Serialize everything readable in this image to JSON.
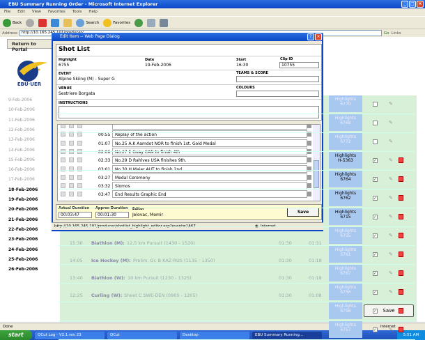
{
  "ie": {
    "title": "EBU Summary Running Order - Microsoft Internet Explorer",
    "menu": [
      "File",
      "Edit",
      "View",
      "Favorites",
      "Tools",
      "Help"
    ],
    "toolbar": {
      "back": "Back",
      "search": "Search",
      "favorites": "Favorites"
    },
    "address_label": "Address",
    "address": "http://10.165.245.101/producer/",
    "go": "Go",
    "links": "Links"
  },
  "page": {
    "return_label": "Return to Portal",
    "logo_text": "EBU·UER",
    "dates": [
      {
        "d": "9-Feb-2006",
        "bold": false
      },
      {
        "d": "10-Feb-2006",
        "bold": false
      },
      {
        "d": "11-Feb-2006",
        "bold": false
      },
      {
        "d": "12-Feb-2006",
        "bold": false
      },
      {
        "d": "13-Feb-2006",
        "bold": false
      },
      {
        "d": "14-Feb-2006",
        "bold": false
      },
      {
        "d": "15-Feb-2006",
        "bold": false
      },
      {
        "d": "16-Feb-2006",
        "bold": false
      },
      {
        "d": "17-Feb-2006",
        "bold": false
      },
      {
        "d": "18-Feb-2006",
        "bold": true
      },
      {
        "d": "19-Feb-2006",
        "bold": true
      },
      {
        "d": "20-Feb-2006",
        "bold": true
      },
      {
        "d": "21-Feb-2006",
        "bold": true
      },
      {
        "d": "22-Feb-2006",
        "bold": true
      },
      {
        "d": "23-Feb-2006",
        "bold": true
      },
      {
        "d": "24-Feb-2006",
        "bold": true
      },
      {
        "d": "25-Feb-2006",
        "bold": true
      },
      {
        "d": "26-Feb-2006",
        "bold": true
      }
    ],
    "highlights": [
      {
        "label": "Highlights",
        "code": "6770",
        "checked": false,
        "dark": false
      },
      {
        "label": "Highlights",
        "code": "6768",
        "checked": false,
        "dark": false
      },
      {
        "label": "Highlights",
        "code": "6772",
        "checked": false,
        "dark": false
      },
      {
        "label": "Highlights",
        "code": "H-5363",
        "checked": true,
        "dark": true
      },
      {
        "label": "Highlights",
        "code": "6764",
        "checked": true,
        "dark": true
      },
      {
        "label": "Highlights",
        "code": "6762",
        "checked": true,
        "dark": true
      },
      {
        "label": "Highlights",
        "code": "6715",
        "checked": true,
        "dark": true
      },
      {
        "label": "Highlights",
        "code": "6755",
        "checked": true,
        "dark": false
      },
      {
        "label": "Highlights",
        "code": "6761",
        "checked": true,
        "dark": false
      },
      {
        "label": "Highlights",
        "code": "6767",
        "checked": true,
        "dark": false
      },
      {
        "label": "Highlights",
        "code": "6756",
        "checked": true,
        "dark": false
      },
      {
        "label": "Highlights",
        "code": "6758",
        "checked": true,
        "dark": false
      },
      {
        "label": "Highlights",
        "code": "6757",
        "checked": true,
        "dark": false
      }
    ],
    "lower_rows": [
      {
        "time": "15:30",
        "sport": "Biathlon (M):",
        "event": "12,5 km Pursuit (1430 - 1520)",
        "dur": "01:30",
        "end": "01:31"
      },
      {
        "time": "14:05",
        "sport": "Ice Hockey (M):",
        "event": "Prelim. Gr. B KAZ-RUS (1135 - 1350)",
        "dur": "01:30",
        "end": "01:18"
      },
      {
        "time": "13:40",
        "sport": "Biathlon (W):",
        "event": "10 km Pursuit (1230 - 1325)",
        "dur": "01:30",
        "end": "01:18"
      },
      {
        "time": "12:25",
        "sport": "Curling (W):",
        "event": "Sheet C SWE-DEN (0905 - 1205)",
        "dur": "01:30",
        "end": "01:08"
      }
    ],
    "save_label": "Save"
  },
  "dialog": {
    "title": "Edit Item -- Web Page Dialog",
    "heading": "Shot List",
    "highlight_label": "Highlight",
    "highlight": "6755",
    "date_label": "Date",
    "date": "19-Feb-2006",
    "start_label": "Start",
    "start": "16:30",
    "clipid_label": "Clip ID",
    "clipid": "10755",
    "event_label": "EVENT",
    "event": "Alpine Skiing (M) - Super G",
    "teams_label": "TEAMS & SCORE",
    "teams": "",
    "venue_label": "VENUE",
    "venue": "Sestriere Borgata",
    "colours_label": "COLOURS",
    "colours": "",
    "instructions_label": "INSTRUCTIONS",
    "instructions": "",
    "shots": [
      {
        "time": "",
        "desc": ""
      },
      {
        "time": "00:55",
        "desc": "Replay of the action"
      },
      {
        "time": "01:07",
        "desc": "No.25 A.K Aamdot NOR to finish 1st. Gold Medal"
      },
      {
        "time": "02:06",
        "desc": "No.27 E Guay CAN to finish 4th"
      },
      {
        "time": "02:33",
        "desc": "No.29 D Rahlves USA finishes 9th."
      },
      {
        "time": "03:01",
        "desc": "No.30 H Maier AUT to finish 2nd."
      },
      {
        "time": "03:27",
        "desc": "Medal Ceremony"
      },
      {
        "time": "03:32",
        "desc": "Slomos"
      },
      {
        "time": "03:47",
        "desc": "End Results Graphic End"
      }
    ],
    "actual_label": "Actual Duration",
    "actual": "00:03:47",
    "approx_label": "Approx Duration",
    "approx": "00:01:30",
    "editor_label": "Editor",
    "editor": "Jelovac, Momir",
    "save_label": "Save",
    "status_url": "http://10.165.245.101/producer/shotlist_highlight_editor.asp?event=1467",
    "status_zone": "Internet"
  },
  "status": {
    "text": "Done",
    "zone": "Internet"
  },
  "taskbar": {
    "start": "start",
    "tasks": [
      "QCut Log - V2.1 rev 23",
      "QCut",
      "Desktop",
      "EBU Summary Running..."
    ],
    "clock": "5:51 AM"
  }
}
